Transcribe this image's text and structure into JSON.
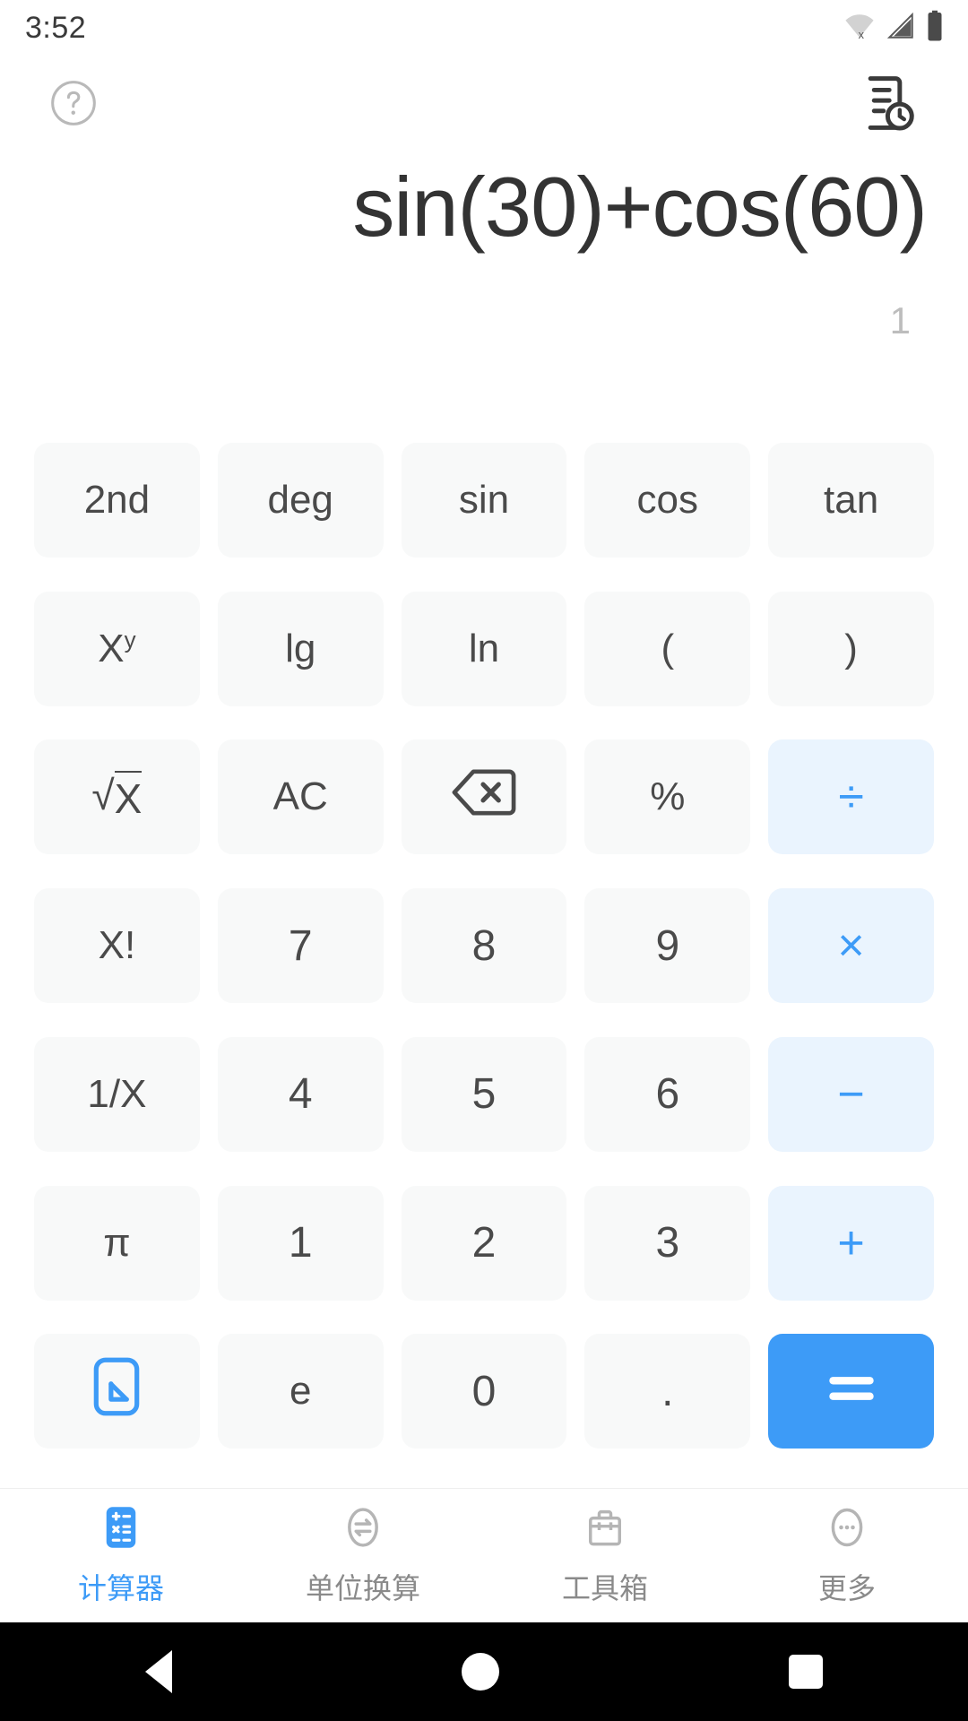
{
  "status_bar": {
    "time": "3:52",
    "icons": [
      "wifi-off-icon",
      "cellular-signal-icon",
      "battery-full-icon"
    ]
  },
  "top_actions": {
    "help_label": "?",
    "help_icon": "help-circle-icon",
    "history_icon": "history-document-icon"
  },
  "display": {
    "expression": "sin(30)+cos(60)",
    "result": "1"
  },
  "keypad": {
    "rows": [
      [
        {
          "label": "2nd",
          "type": "func"
        },
        {
          "label": "deg",
          "type": "func"
        },
        {
          "label": "sin",
          "type": "func"
        },
        {
          "label": "cos",
          "type": "func"
        },
        {
          "label": "tan",
          "type": "func"
        }
      ],
      [
        {
          "label": "Xʸ",
          "type": "func",
          "name": "power"
        },
        {
          "label": "lg",
          "type": "func"
        },
        {
          "label": "ln",
          "type": "func"
        },
        {
          "label": "(",
          "type": "func"
        },
        {
          "label": ")",
          "type": "func"
        }
      ],
      [
        {
          "label": "√X",
          "type": "func",
          "name": "sqrt"
        },
        {
          "label": "AC",
          "type": "func"
        },
        {
          "label": "",
          "type": "func",
          "name": "backspace",
          "icon": "backspace-icon"
        },
        {
          "label": "%",
          "type": "func"
        },
        {
          "label": "÷",
          "type": "op",
          "name": "divide"
        }
      ],
      [
        {
          "label": "X!",
          "type": "func",
          "name": "factorial"
        },
        {
          "label": "7",
          "type": "num"
        },
        {
          "label": "8",
          "type": "num"
        },
        {
          "label": "9",
          "type": "num"
        },
        {
          "label": "×",
          "type": "op",
          "name": "multiply"
        }
      ],
      [
        {
          "label": "1/X",
          "type": "func",
          "name": "reciprocal"
        },
        {
          "label": "4",
          "type": "num"
        },
        {
          "label": "5",
          "type": "num"
        },
        {
          "label": "6",
          "type": "num"
        },
        {
          "label": "−",
          "type": "op",
          "name": "minus"
        }
      ],
      [
        {
          "label": "π",
          "type": "func",
          "name": "pi"
        },
        {
          "label": "1",
          "type": "num"
        },
        {
          "label": "2",
          "type": "num"
        },
        {
          "label": "3",
          "type": "num"
        },
        {
          "label": "+",
          "type": "op",
          "name": "plus"
        }
      ],
      [
        {
          "label": "",
          "type": "func",
          "name": "collapse-keypad",
          "icon": "collapse-arrow-icon"
        },
        {
          "label": "e",
          "type": "func"
        },
        {
          "label": "0",
          "type": "num"
        },
        {
          "label": ".",
          "type": "num",
          "name": "decimal"
        },
        {
          "label": "=",
          "type": "equals",
          "name": "equals"
        }
      ]
    ]
  },
  "bottom_nav": {
    "items": [
      {
        "label": "计算器",
        "icon": "calculator-icon",
        "active": true
      },
      {
        "label": "单位换算",
        "icon": "unit-convert-icon",
        "active": false
      },
      {
        "label": "工具箱",
        "icon": "toolbox-icon",
        "active": false
      },
      {
        "label": "更多",
        "icon": "more-dots-icon",
        "active": false
      }
    ]
  },
  "android_nav": {
    "back": "back-triangle-icon",
    "home": "home-circle-icon",
    "recents": "recents-square-icon"
  },
  "colors": {
    "accent": "#3d9bf7",
    "op_background": "#eaf4fe",
    "key_background": "#f8f9f9",
    "expression_text": "#333333",
    "result_text": "#bdbdbd"
  }
}
